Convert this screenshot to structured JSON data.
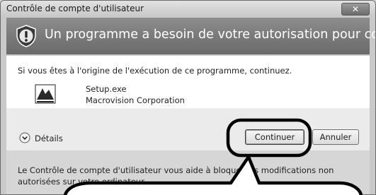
{
  "window": {
    "title": "Contrôle de compte d'utilisateur",
    "close_glyph": "✕"
  },
  "banner": {
    "icon": "shield-warning-icon",
    "message": "Un programme a besoin de votre autorisation pour continuer."
  },
  "content": {
    "intro": "Si vous êtes à l'origine de l'exécution de ce programme, continuez.",
    "program": {
      "icon": "setup-program-icon",
      "name": "Setup.exe",
      "publisher": "Macrovision Corporation"
    }
  },
  "actions": {
    "details_label": "Détails",
    "continue_label": "Continuer",
    "cancel_label": "Annuler"
  },
  "footer": {
    "text": "Le Contrôle de compte d'utilisateur vous aide à bloquer les modifications non autorisées sur votre ordinateur."
  },
  "colors": {
    "banner": "#7a7a7a",
    "callout_stroke": "#000000"
  }
}
